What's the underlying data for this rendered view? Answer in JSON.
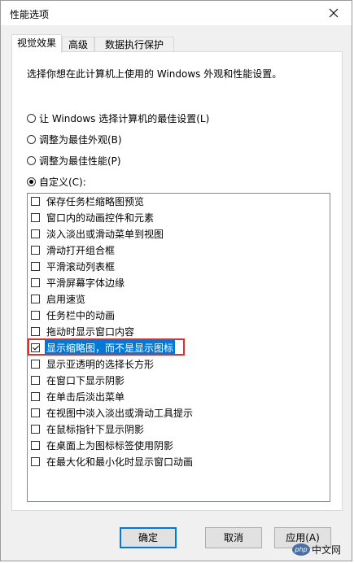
{
  "window": {
    "title": "性能选项"
  },
  "tabs": [
    {
      "label": "视觉效果",
      "active": true
    },
    {
      "label": "高级",
      "active": false
    },
    {
      "label": "数据执行保护",
      "active": false
    }
  ],
  "description": "选择你想在此计算机上使用的 Windows 外观和性能设置。",
  "radios": [
    {
      "label": "让 Windows 选择计算机的最佳设置(L)",
      "selected": false
    },
    {
      "label": "调整为最佳外观(B)",
      "selected": false
    },
    {
      "label": "调整为最佳性能(P)",
      "selected": false
    },
    {
      "label": "自定义(C):",
      "selected": true
    }
  ],
  "options": [
    {
      "label": "保存任务栏缩略图预览",
      "checked": false
    },
    {
      "label": "窗口内的动画控件和元素",
      "checked": false
    },
    {
      "label": "淡入淡出或滑动菜单到视图",
      "checked": false
    },
    {
      "label": "滑动打开组合框",
      "checked": false
    },
    {
      "label": "平滑滚动列表框",
      "checked": false
    },
    {
      "label": "平滑屏幕字体边缘",
      "checked": false
    },
    {
      "label": "启用速览",
      "checked": false
    },
    {
      "label": "任务栏中的动画",
      "checked": false
    },
    {
      "label": "拖动时显示窗口内容",
      "checked": false
    },
    {
      "label": "显示缩略图，而不是显示图标",
      "checked": true,
      "selected": true
    },
    {
      "label": "显示亚透明的选择长方形",
      "checked": false
    },
    {
      "label": "在窗口下显示阴影",
      "checked": false
    },
    {
      "label": "在单击后淡出菜单",
      "checked": false
    },
    {
      "label": "在视图中淡入淡出或滑动工具提示",
      "checked": false
    },
    {
      "label": "在鼠标指针下显示阴影",
      "checked": false
    },
    {
      "label": "在桌面上为图标标签使用阴影",
      "checked": false
    },
    {
      "label": "在最大化和最小化时显示窗口动画",
      "checked": false
    }
  ],
  "buttons": {
    "ok": "确定",
    "cancel": "取消",
    "apply": "应用(A)"
  },
  "watermark": {
    "logo": "php",
    "text": "中文网"
  }
}
